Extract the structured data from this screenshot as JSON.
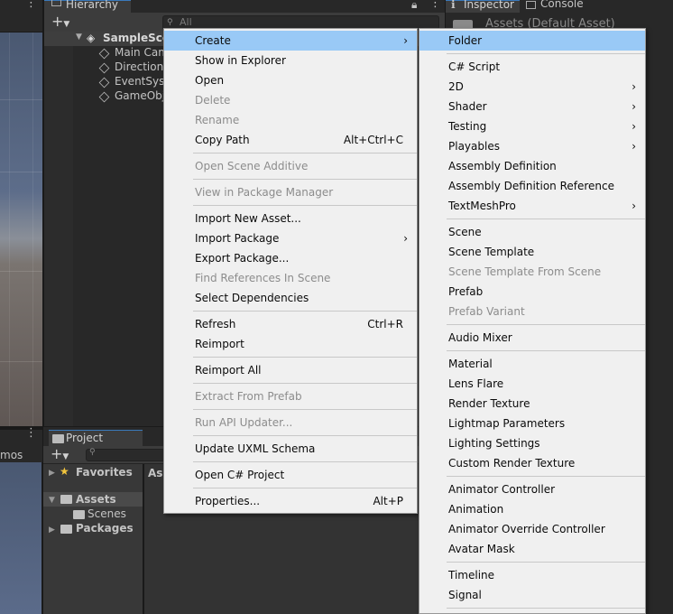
{
  "hierarchy": {
    "tab_label": "Hierarchy",
    "search_placeholder": "All",
    "scene_name": "SampleSce",
    "objects": [
      "Main Cam",
      "Directiona",
      "EventSys",
      "GameObje"
    ]
  },
  "inspector": {
    "tab_label": "Inspector",
    "console_label": "Console",
    "assets_title": "Assets (Default Asset)"
  },
  "scene": {
    "gizmos_label": "mos"
  },
  "project": {
    "tab_label": "Project",
    "favorites": "Favorites",
    "assets": "Assets",
    "scenes": "Scenes",
    "packages": "Packages",
    "right_header": "As"
  },
  "context_menu": {
    "items": [
      {
        "label": "Create",
        "state": "selected",
        "submenu": true
      },
      {
        "label": "Show in Explorer"
      },
      {
        "label": "Open"
      },
      {
        "label": "Delete",
        "state": "disabled"
      },
      {
        "label": "Rename",
        "state": "disabled"
      },
      {
        "label": "Copy Path",
        "shortcut": "Alt+Ctrl+C"
      },
      {
        "label": "Open Scene Additive",
        "state": "disabled"
      },
      {
        "label": "View in Package Manager",
        "state": "disabled"
      },
      {
        "label": "Import New Asset..."
      },
      {
        "label": "Import Package",
        "submenu": true
      },
      {
        "label": "Export Package..."
      },
      {
        "label": "Find References In Scene",
        "state": "disabled"
      },
      {
        "label": "Select Dependencies"
      },
      {
        "label": "Refresh",
        "shortcut": "Ctrl+R"
      },
      {
        "label": "Reimport"
      },
      {
        "label": "Reimport All"
      },
      {
        "label": "Extract From Prefab",
        "state": "disabled"
      },
      {
        "label": "Run API Updater...",
        "state": "disabled"
      },
      {
        "label": "Update UXML Schema"
      },
      {
        "label": "Open C# Project"
      },
      {
        "label": "Properties...",
        "shortcut": "Alt+P"
      }
    ]
  },
  "create_submenu": {
    "items": [
      {
        "label": "Folder",
        "state": "selected"
      },
      {
        "label": "C# Script"
      },
      {
        "label": "2D",
        "submenu": true
      },
      {
        "label": "Shader",
        "submenu": true
      },
      {
        "label": "Testing",
        "submenu": true
      },
      {
        "label": "Playables",
        "submenu": true
      },
      {
        "label": "Assembly Definition"
      },
      {
        "label": "Assembly Definition Reference"
      },
      {
        "label": "TextMeshPro",
        "submenu": true
      },
      {
        "label": "Scene"
      },
      {
        "label": "Scene Template"
      },
      {
        "label": "Scene Template From Scene",
        "state": "disabled"
      },
      {
        "label": "Prefab"
      },
      {
        "label": "Prefab Variant",
        "state": "disabled"
      },
      {
        "label": "Audio Mixer"
      },
      {
        "label": "Material"
      },
      {
        "label": "Lens Flare"
      },
      {
        "label": "Render Texture"
      },
      {
        "label": "Lightmap Parameters"
      },
      {
        "label": "Lighting Settings"
      },
      {
        "label": "Custom Render Texture"
      },
      {
        "label": "Animator Controller"
      },
      {
        "label": "Animation"
      },
      {
        "label": "Animator Override Controller"
      },
      {
        "label": "Avatar Mask"
      },
      {
        "label": "Timeline"
      },
      {
        "label": "Signal"
      }
    ]
  }
}
